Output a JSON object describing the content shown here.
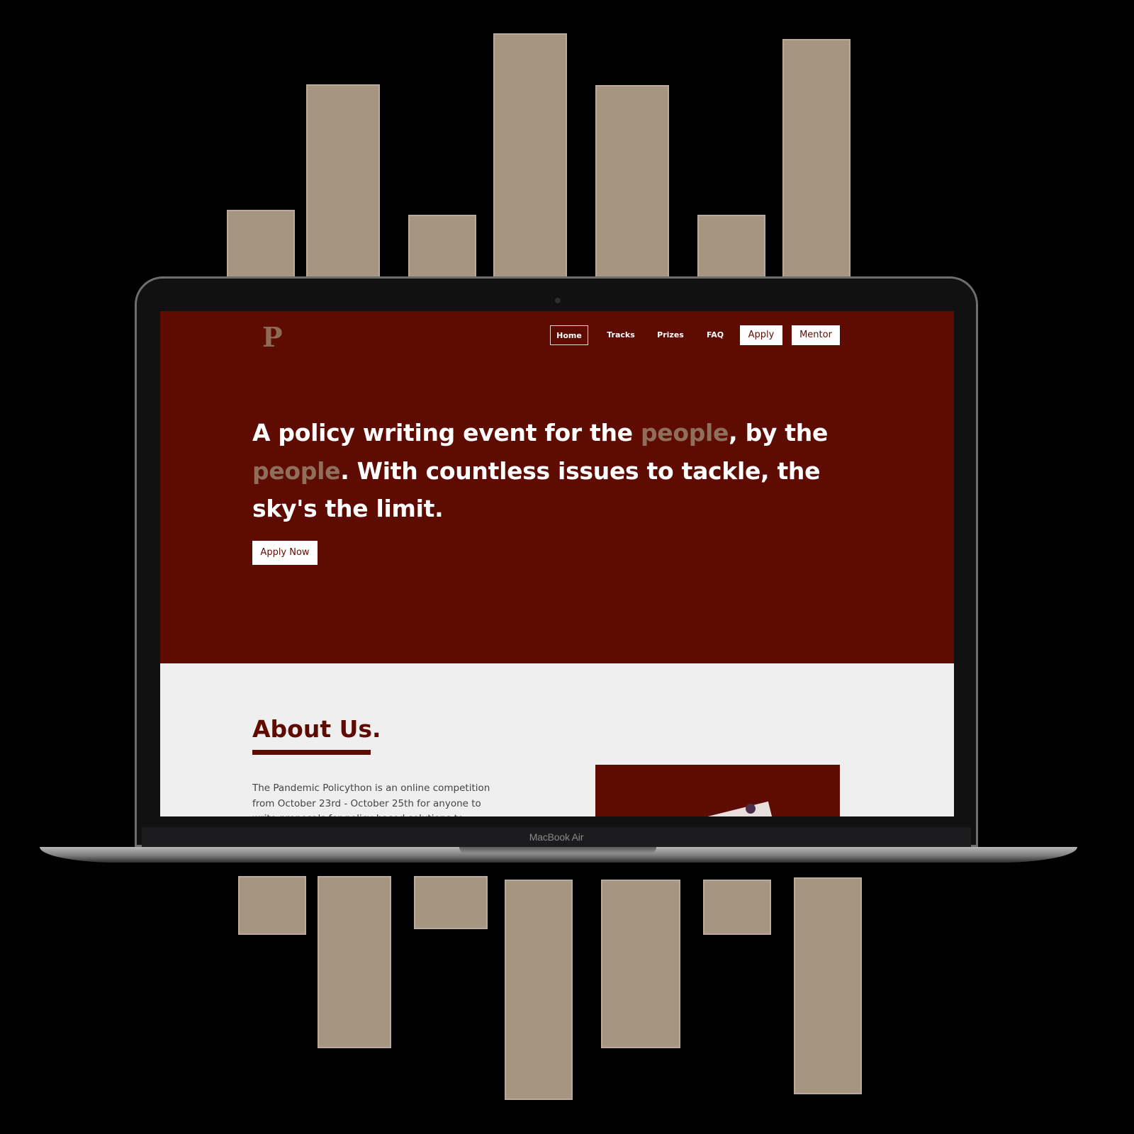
{
  "decor": {
    "bar_color": "#a69581",
    "top_bar_count": 7,
    "bottom_bar_count": 7
  },
  "device": {
    "label": "MacBook Air"
  },
  "site": {
    "brand_color": "#5e0b02",
    "accent_color": "#8f6f5c",
    "logo": "P",
    "nav": {
      "home": "Home",
      "tracks": "Tracks",
      "prizes": "Prizes",
      "faq": "FAQ",
      "apply": "Apply",
      "mentor": "Mentor"
    },
    "hero": {
      "headline_part1": "A policy writing event for the ",
      "headline_accent1": "people",
      "headline_part2": ", by the ",
      "headline_accent2": "people",
      "headline_part3": ". With countless issues to tackle, the sky's the limit.",
      "cta_label": "Apply Now"
    },
    "about": {
      "title": "About Us.",
      "text": "The Pandemic Policython is an online competition from October 23rd - October 25th for anyone to write proposals for policy-based solutions to"
    }
  }
}
